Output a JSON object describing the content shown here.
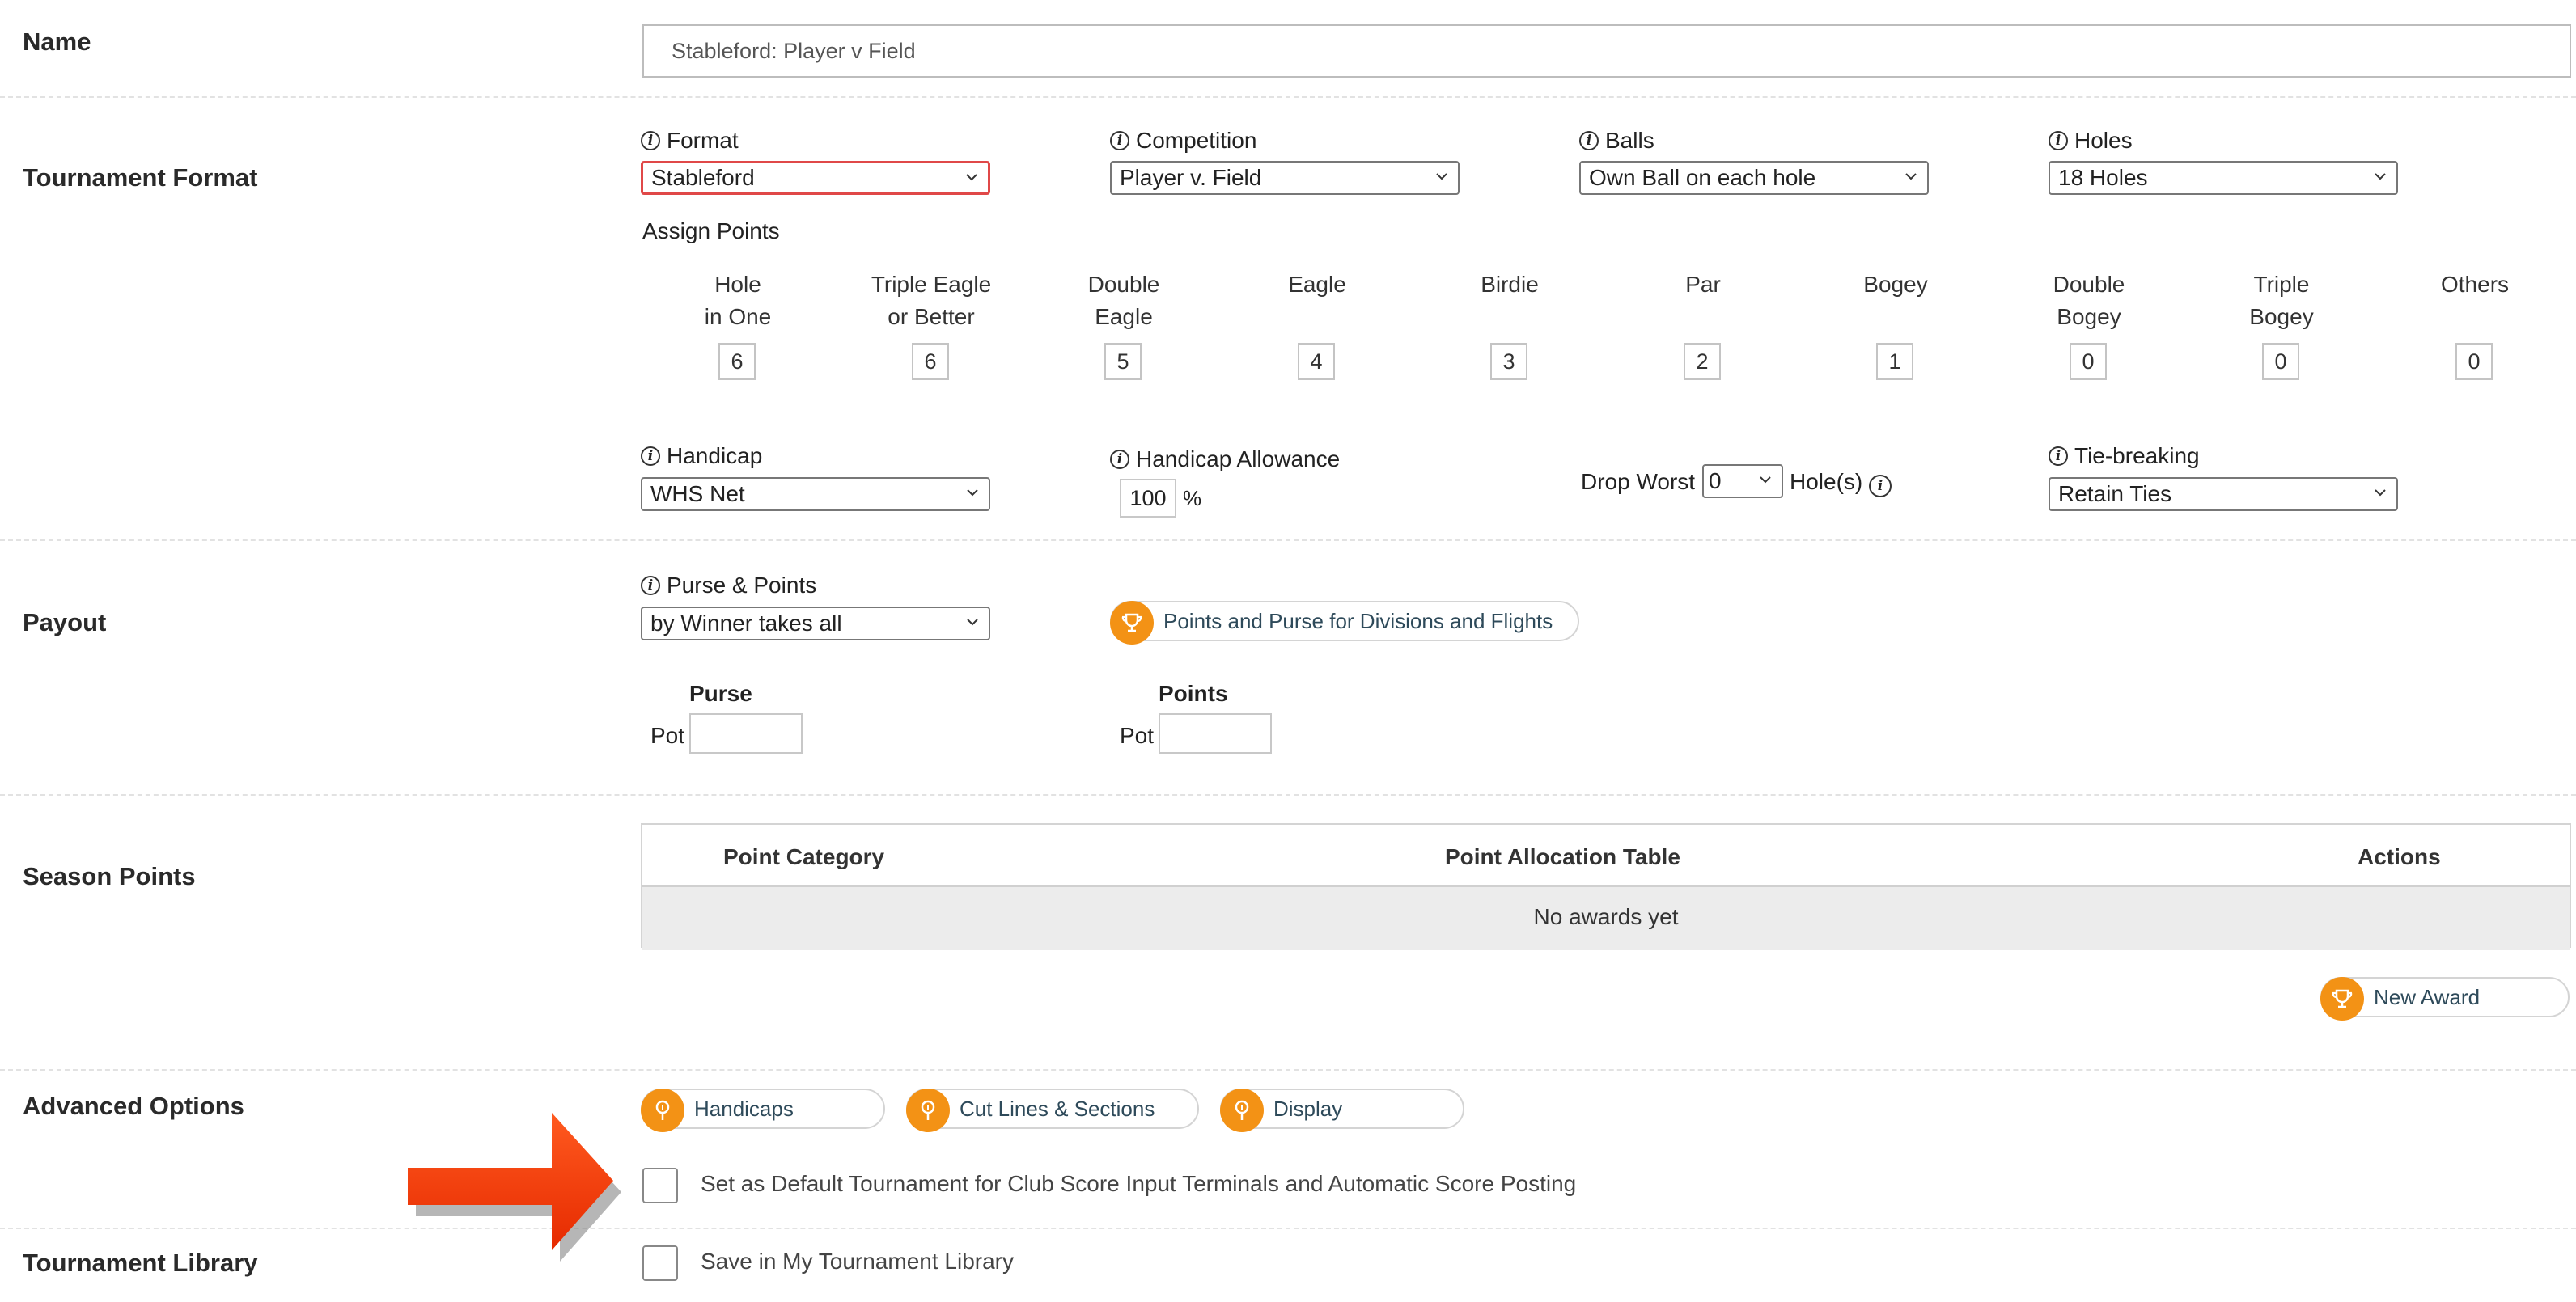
{
  "sections": {
    "name": "Name",
    "format": "Tournament Format",
    "payout": "Payout",
    "season": "Season Points",
    "advanced": "Advanced Options",
    "library": "Tournament Library"
  },
  "name_value": "Stableford: Player v Field",
  "format": {
    "format_label": "Format",
    "format_value": "Stableford",
    "competition_label": "Competition",
    "competition_value": "Player v. Field",
    "balls_label": "Balls",
    "balls_value": "Own Ball on each hole",
    "holes_label": "Holes",
    "holes_value": "18 Holes",
    "assign_points": "Assign Points",
    "points": [
      {
        "l1": "Hole",
        "l2": "in One",
        "v": "6"
      },
      {
        "l1": "Triple Eagle",
        "l2": "or Better",
        "v": "6"
      },
      {
        "l1": "Double",
        "l2": "Eagle",
        "v": "5"
      },
      {
        "l1": "Eagle",
        "l2": "",
        "v": "4"
      },
      {
        "l1": "Birdie",
        "l2": "",
        "v": "3"
      },
      {
        "l1": "Par",
        "l2": "",
        "v": "2"
      },
      {
        "l1": "Bogey",
        "l2": "",
        "v": "1"
      },
      {
        "l1": "Double",
        "l2": "Bogey",
        "v": "0"
      },
      {
        "l1": "Triple",
        "l2": "Bogey",
        "v": "0"
      },
      {
        "l1": "Others",
        "l2": "",
        "v": "0"
      }
    ],
    "handicap_label": "Handicap",
    "handicap_value": "WHS Net",
    "allowance_label": "Handicap Allowance",
    "allowance_value": "100",
    "allowance_unit": "%",
    "drop_worst_label": "Drop Worst",
    "drop_worst_value": "0",
    "drop_worst_suffix": "Hole(s)",
    "tiebreak_label": "Tie-breaking",
    "tiebreak_value": "Retain Ties"
  },
  "payout": {
    "purse_points_label": "Purse & Points",
    "purse_points_value": "by Winner takes all",
    "divisions_button": "Points and Purse for Divisions and Flights",
    "purse_title": "Purse",
    "points_title": "Points",
    "pot_label": "Pot"
  },
  "season": {
    "col1": "Point Category",
    "col2": "Point Allocation Table",
    "col3": "Actions",
    "empty": "No awards yet",
    "new_award": "New Award"
  },
  "advanced": {
    "handicaps": "Handicaps",
    "cut_lines": "Cut Lines & Sections",
    "display": "Display",
    "default_tournament": "Set as Default Tournament for Club Score Input Terminals and Automatic Score Posting"
  },
  "library": {
    "save": "Save in My Tournament Library"
  },
  "colors": {
    "accent": "#f39215",
    "arrow": "#ff3d0d",
    "invalid_border": "#e04848"
  }
}
